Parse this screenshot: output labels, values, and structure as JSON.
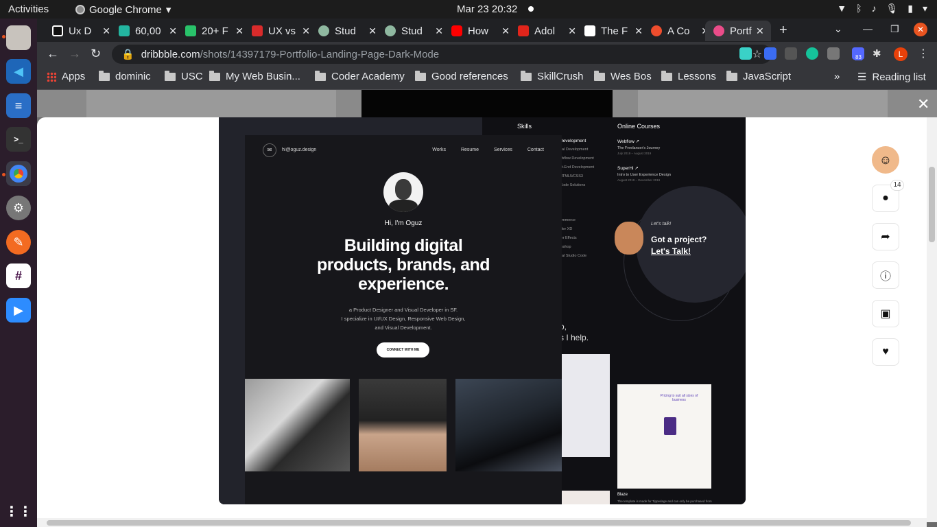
{
  "topbar": {
    "activities": "Activities",
    "app_name": "Google Chrome",
    "clock": "Mar 23  20:32"
  },
  "tabs": [
    {
      "title": "Ux D",
      "color": "#111111"
    },
    {
      "title": "60,00",
      "color": "#23b5a0"
    },
    {
      "title": "20+ F",
      "color": "#29c26a"
    },
    {
      "title": "UX vs",
      "color": "#d92b2b"
    },
    {
      "title": "Stud",
      "color": "#8fb8a0"
    },
    {
      "title": "Stud",
      "color": "#8fb8a0"
    },
    {
      "title": "How",
      "color": "#ff0000"
    },
    {
      "title": "Adol",
      "color": "#e1251b"
    },
    {
      "title": "The F",
      "color": "#111111"
    },
    {
      "title": "A Co",
      "color": "#ee4d2d"
    },
    {
      "title": "Portf",
      "color": "#ea4c89"
    }
  ],
  "omnibox": {
    "host": "dribbble.com",
    "path": "/shots/14397179-Portfolio-Landing-Page-Dark-Mode"
  },
  "profile_initial": "L",
  "extension_badge": "83",
  "bookmarks": {
    "apps": "Apps",
    "items": [
      "dominic",
      "USC",
      "My Web Busin...",
      "Coder Academy",
      "Good references",
      "SkillCrush",
      "Wes Bos",
      "Lessons",
      "JavaScript"
    ],
    "overflow": "»",
    "reading_list": "Reading list"
  },
  "shot": {
    "nav_email": "hi@oguz.design",
    "nav_links": [
      "Works",
      "Resume",
      "Services",
      "Contact"
    ],
    "greeting": "Hi, I'm Oguz",
    "headline": "Building digital products, brands, and experience.",
    "intro_line1": "a Product Designer and Visual Developer in SF.",
    "intro_line2": "I specialize in UI/UX Design, Responsive Web Design,",
    "intro_line3": "and Visual Development.",
    "cta": "CONNECT WITH ME",
    "skills_label": "Skills",
    "courses_label": "Online Courses",
    "course1_title": "Webflow ↗",
    "course1_sub": "The Freelancer's Journey",
    "course1_date": "July 2019 – August 2019",
    "course2_title": "SuperHi ↗",
    "course2_sub": "Intro to User Experience Design",
    "course2_date": "August 2019 – December 2019",
    "skills_list": [
      "Development",
      "ual Development",
      "ebflow Development",
      "nt-End Development",
      "HTML5/CSS3",
      "Code Solutions",
      "ommerce",
      "ider XD",
      "ter Effects",
      "toshop",
      "ual Studio Code"
    ],
    "partial_text_1": "o,",
    "partial_text_2": "s I help.",
    "talk_small": "Let's talk!",
    "talk_line1": "Got a project?",
    "talk_line2": "Let's Talk!",
    "card_caption": "Blaze",
    "card_caption_small": "The template is made for Tippedage and can only be purchased from",
    "card_mid_caption": "Pricing to suit all sizes of business"
  },
  "actions": {
    "comments_count": "14"
  }
}
